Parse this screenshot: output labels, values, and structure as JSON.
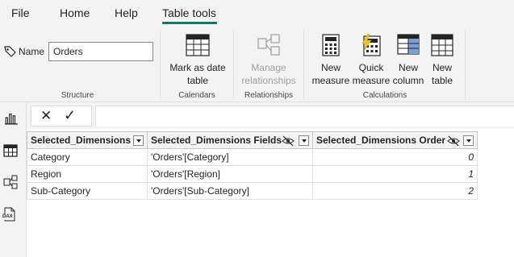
{
  "menu": {
    "items": [
      "File",
      "Home",
      "Help",
      "Table tools"
    ],
    "active": "Table tools",
    "accent_color": "#117865"
  },
  "ribbon": {
    "name_label": "Name",
    "name_value": "Orders",
    "groups": {
      "structure": "Structure",
      "calendars": "Calendars",
      "relationships": "Relationships",
      "calculations": "Calculations"
    },
    "buttons": {
      "mark_as_date_table": [
        "Mark as date",
        "table"
      ],
      "manage_relationships": [
        "Manage",
        "relationships"
      ],
      "new_measure": [
        "New",
        "measure"
      ],
      "quick_measure": [
        "Quick",
        "measure"
      ],
      "new_column": [
        "New",
        "column"
      ],
      "new_table": [
        "New",
        "table"
      ]
    }
  },
  "leftnav": {
    "icons": [
      "report-view-icon",
      "table-view-icon",
      "model-view-icon",
      "dax-query-view-icon"
    ],
    "dax_label": "DAX"
  },
  "formula_bar": {
    "cancel_glyph": "✕",
    "commit_glyph": "✓",
    "value": ""
  },
  "table": {
    "columns": [
      "Selected_Dimensions",
      "Selected_Dimensions Fields",
      "Selected_Dimensions Order"
    ],
    "rows": [
      [
        "Category",
        "'Orders'[Category]",
        "0"
      ],
      [
        "Region",
        "'Orders'[Region]",
        "1"
      ],
      [
        "Sub-Category",
        "'Orders'[Sub-Category]",
        "2"
      ]
    ]
  }
}
